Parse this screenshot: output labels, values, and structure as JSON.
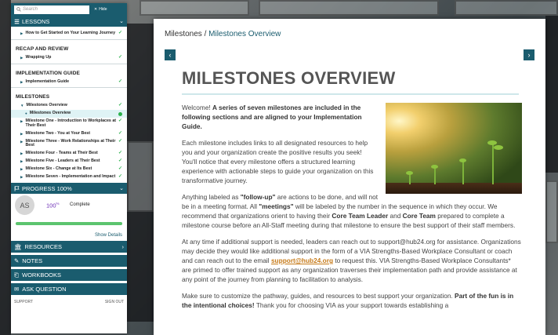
{
  "sidebar": {
    "search_placeholder": "Search",
    "hide_label": "Hide",
    "lessons_header": "LESSONS",
    "groups": [
      {
        "title": "",
        "items": [
          {
            "label": "How to Get Started on Your Learning Journey",
            "done": true
          }
        ]
      },
      {
        "title": "RECAP AND REVIEW",
        "items": [
          {
            "label": "Wrapping Up",
            "done": true
          }
        ]
      },
      {
        "title": "IMPLEMENTATION GUIDE",
        "items": [
          {
            "label": "Implementation Guide",
            "done": true
          }
        ]
      }
    ],
    "milestones_title": "MILESTONES",
    "milestones_parent": "Milestones Overview",
    "milestones_active": "Milestones Overview",
    "milestone_items": [
      "Milestone One - Introduction to Workplaces at Their Best",
      "Milestone Two - You at Your Best",
      "Milestone Three - Work Relationships at Their Best",
      "Milestone Four - Teams at Their Best",
      "Milestone Five - Leaders at Their Best",
      "Milestone Six - Change at Its Best",
      "Milestone Seven - Implementation and Impact"
    ],
    "progress_header": "PROGRESS 100%",
    "avatar_initials": "AS",
    "progress_value": "100",
    "progress_unit": "%",
    "progress_status": "Complete",
    "progress_fraction": 1.0,
    "show_details": "Show Details",
    "resources": "RESOURCES",
    "notes": "NOTES",
    "workbooks": "WORKBOOKS",
    "ask_question": "ASK QUESTION",
    "support": "SUPPORT",
    "sign_out": "SIGN OUT"
  },
  "main": {
    "breadcrumb_root": "Milestones",
    "breadcrumb_sep": " / ",
    "breadcrumb_current": "Milestones Overview",
    "title": "MILESTONES OVERVIEW",
    "p1_lead": "Welcome! ",
    "p1_bold": "A series of seven milestones are included in the following sections and are aligned to your Implementation Guide.",
    "p2": "Each milestone includes links to all designated resources to help you and your organization create the positive results you seek! You'll notice that every milestone offers a structured learning experience with actionable steps to guide your organization on this transformative journey.",
    "p3_a": "Anything labeled as ",
    "p3_b": "\"follow-up\"",
    "p3_c": " are actions to be done, and will not be in a meeting format. All ",
    "p3_d": "\"meetings\"",
    "p3_e": " will be labeled by the number in the sequence in which they occur. We recommend that organizations orient to having their ",
    "p3_f": "Core Team Leader",
    "p3_g": " and ",
    "p3_h": "Core Team",
    "p3_i": " prepared to complete a milestone course before an All-Staff meeting during that milestone to ensure the best support of their staff members.",
    "p4_a": "At any time if additional support is needed, leaders can reach out to support@hub24.org for assistance. Organizations may decide they would like additional support in the form of a VIA Strengths-Based Workplace Consultant or coach and can reach out to the email ",
    "p4_link": "support@hub24.org",
    "p4_b": " to request this. VIA Strengths-Based Workplace Consultants* are primed to offer trained support as any organization traverses their implementation path and provide assistance at any point of the journey from planning to facilitation to analysis.",
    "p5_a": "Make sure to customize the pathway, guides, and resources to best support your organization. ",
    "p5_b": "Part of the fun is in the intentional choices!",
    "p5_c": " Thank you for choosing VIA as your support towards establishing a"
  }
}
